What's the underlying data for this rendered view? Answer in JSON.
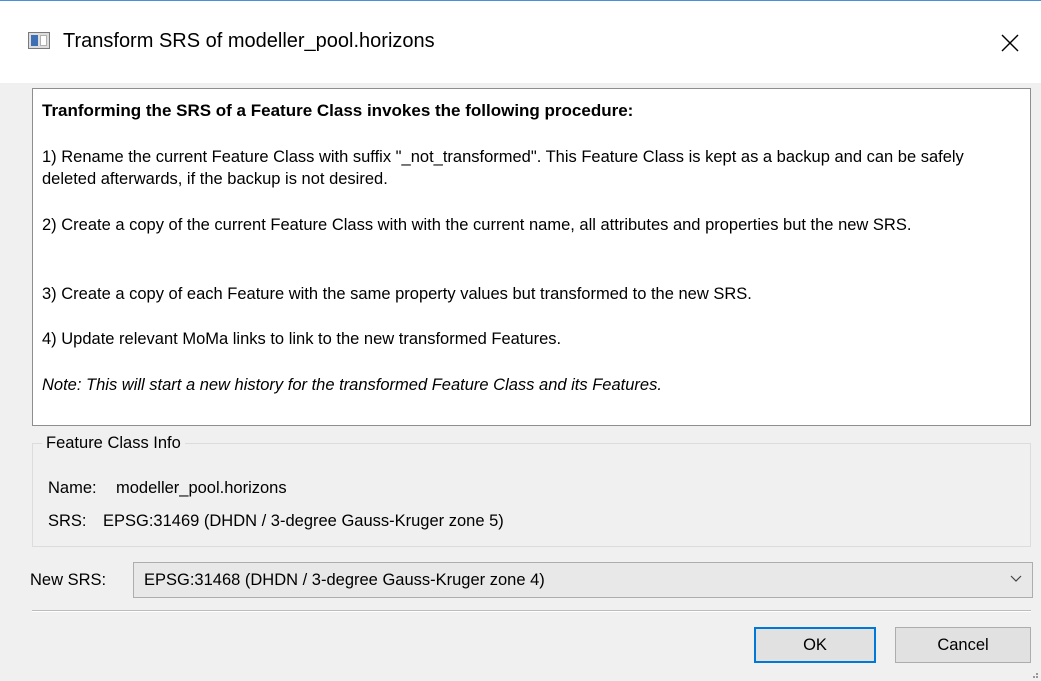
{
  "window": {
    "title": "Transform SRS of modeller_pool.horizons",
    "app_icon": "window-icon",
    "close_icon": "close-icon"
  },
  "description": {
    "heading": "Tranforming the SRS of a Feature Class invokes the following procedure:",
    "steps": [
      "1) Rename the current Feature Class with suffix \"_not_transformed\". This Feature Class is kept as a backup and can be safely deleted afterwards, if the backup is not desired.",
      "2) Create a copy of the current Feature Class with with the current name, all attributes and properties but the new SRS.",
      "3) Create a copy of each Feature with the same property values but transformed to the new SRS.",
      "4) Update relevant MoMa links to link to the new transformed Features."
    ],
    "note": "Note: This will start a new history for the transformed Feature Class and its Features."
  },
  "feature_class_info": {
    "title": "Feature Class Info",
    "name_label": "Name:",
    "name_value": "modeller_pool.horizons",
    "srs_label": "SRS:",
    "srs_value": "EPSG:31469 (DHDN / 3-degree Gauss-Kruger zone 5)"
  },
  "new_srs": {
    "label": "New SRS:",
    "selected": "EPSG:31468 (DHDN / 3-degree Gauss-Kruger zone 4)",
    "dropdown_icon": "chevron-down-icon"
  },
  "buttons": {
    "ok": "OK",
    "cancel": "Cancel"
  },
  "colors": {
    "accent": "#0078d7",
    "background": "#f0f0f0"
  }
}
